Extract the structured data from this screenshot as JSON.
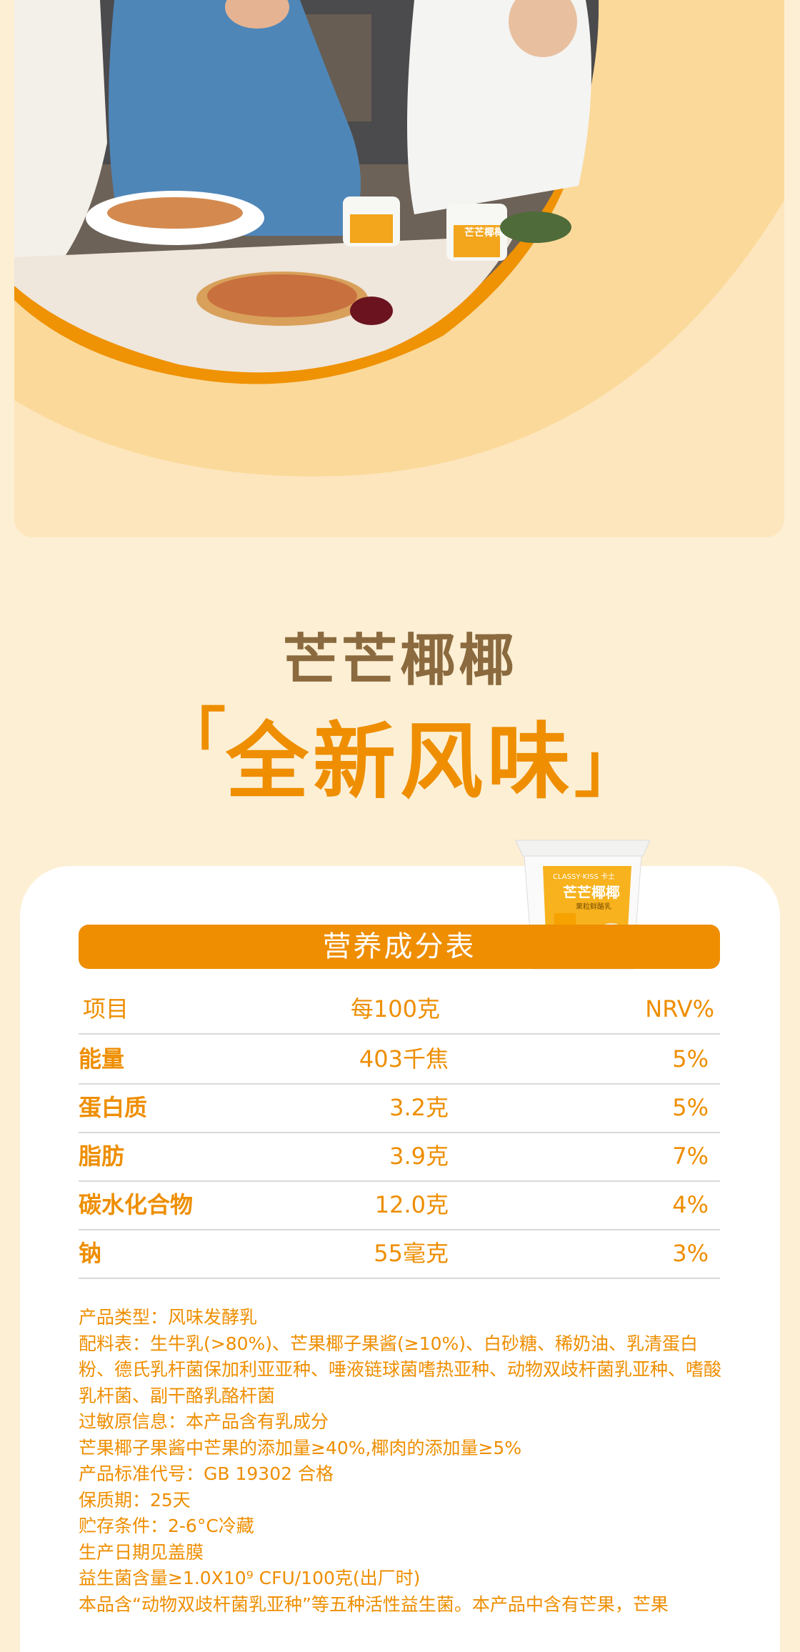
{
  "colors": {
    "page_bg": "#fdefd4",
    "card_bg": "#fde6bd",
    "accent": "#ee8e00",
    "title_brown": "#8a6a3e"
  },
  "photo": {
    "cup_label": "芒芒椰椰"
  },
  "title": {
    "line1": "芒芒椰椰",
    "line2": "全新风味",
    "bracket_open": "「",
    "bracket_close": "」"
  },
  "product_cup": {
    "brand": "CLASSY·KISS 卡士",
    "name": "芒芒椰椰",
    "sub": "果粒鲜酪乳"
  },
  "nutrition": {
    "title": "营养成分表",
    "headers": [
      "项目",
      "每100克",
      "NRV%"
    ],
    "rows": [
      {
        "item": "能量",
        "per100": "403千焦",
        "nrv": "5%"
      },
      {
        "item": "蛋白质",
        "per100": "3.2克",
        "nrv": "5%"
      },
      {
        "item": "脂肪",
        "per100": "3.9克",
        "nrv": "7%"
      },
      {
        "item": "碳水化合物",
        "per100": "12.0克",
        "nrv": "4%"
      },
      {
        "item": "钠",
        "per100": "55毫克",
        "nrv": "3%"
      }
    ]
  },
  "notes": [
    "产品类型：风味发酵乳",
    "配料表：生牛乳(>80%)、芒果椰子果酱(≥10%)、白砂糖、稀奶油、乳清蛋白粉、德氏乳杆菌保加利亚亚种、唾液链球菌嗜热亚种、动物双歧杆菌乳亚种、嗜酸乳杆菌、副干酪乳酪杆菌",
    "过敏原信息：本产品含有乳成分",
    "芒果椰子果酱中芒果的添加量≥40%,椰肉的添加量≥5%",
    "产品标准代号：GB 19302 合格",
    "保质期：25天",
    "贮存条件：2-6°C冷藏",
    "生产日期见盖膜",
    "益生菌含量≥1.0X10⁹ CFU/100克(出厂时)",
    "本品含“动物双歧杆菌乳亚种”等五种活性益生菌。本产品中含有芒果，芒果"
  ]
}
